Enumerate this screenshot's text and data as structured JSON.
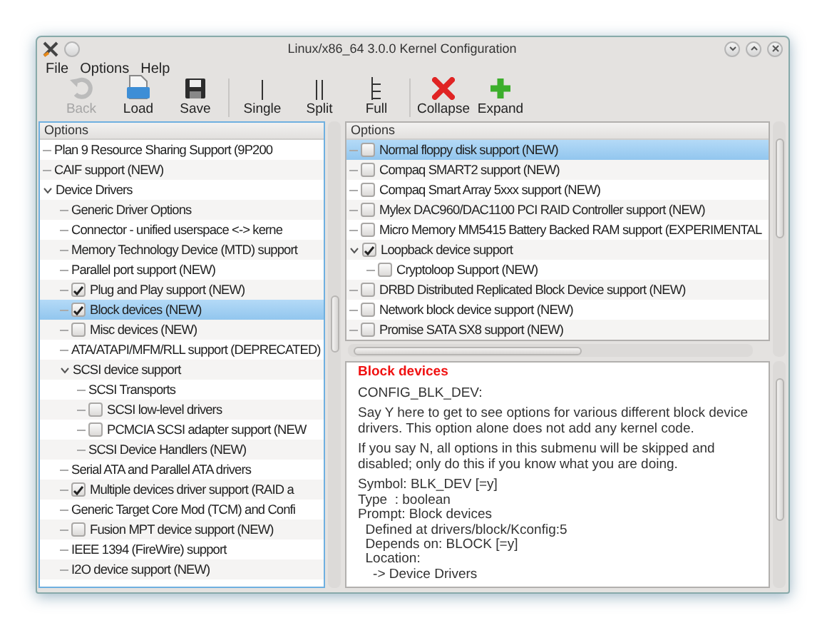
{
  "window": {
    "title": "Linux/x86_64 3.0.0 Kernel Configuration"
  },
  "menu": [
    "File",
    "Options",
    "Help"
  ],
  "toolbar": [
    [
      {
        "label": "Back",
        "disabled": true
      },
      {
        "label": "Load",
        "disabled": false
      },
      {
        "label": "Save",
        "disabled": false
      }
    ],
    [
      {
        "label": "Single",
        "disabled": false
      },
      {
        "label": "Split",
        "disabled": false
      },
      {
        "label": "Full",
        "disabled": false
      }
    ],
    [
      {
        "label": "Collapse",
        "disabled": false
      },
      {
        "label": "Expand",
        "disabled": false
      }
    ]
  ],
  "menu_tree": {
    "header": "Options",
    "items": [
      {
        "label": "Plan 9 Resource Sharing Support (9P200",
        "kind": "plain",
        "selected": false
      },
      {
        "label": "CAIF support (NEW)",
        "kind": "plain",
        "selected": false
      },
      {
        "label": "Device Drivers",
        "kind": "plain",
        "selected": false,
        "expanded": true,
        "children": [
          {
            "label": "Generic Driver Options",
            "kind": "plain",
            "selected": false
          },
          {
            "label": "Connector - unified userspace <-> kerne",
            "kind": "plain",
            "selected": false
          },
          {
            "label": "Memory Technology Device (MTD) support",
            "kind": "plain",
            "selected": false
          },
          {
            "label": "Parallel port support (NEW)",
            "kind": "plain",
            "selected": false
          },
          {
            "label": "Plug and Play support (NEW)",
            "kind": "check",
            "checked": true,
            "selected": false
          },
          {
            "label": "Block devices (NEW)",
            "kind": "check",
            "checked": true,
            "selected": true
          },
          {
            "label": "Misc devices (NEW)",
            "kind": "check",
            "checked": false,
            "selected": false
          },
          {
            "label": "ATA/ATAPI/MFM/RLL support (DEPRECATED)",
            "kind": "plain",
            "selected": false
          },
          {
            "label": "SCSI device support",
            "kind": "plain",
            "selected": false,
            "expanded": true,
            "children": [
              {
                "label": "SCSI Transports",
                "kind": "plain",
                "selected": false
              },
              {
                "label": "SCSI low-level drivers",
                "kind": "check",
                "checked": false,
                "selected": false
              },
              {
                "label": "PCMCIA SCSI adapter support (NEW",
                "kind": "check",
                "checked": false,
                "selected": false
              },
              {
                "label": "SCSI Device Handlers (NEW)",
                "kind": "plain",
                "selected": false
              }
            ]
          },
          {
            "label": "Serial ATA and Parallel ATA drivers",
            "kind": "plain",
            "selected": false
          },
          {
            "label": "Multiple devices driver support (RAID a",
            "kind": "check",
            "checked": true,
            "selected": false
          },
          {
            "label": "Generic Target Core Mod (TCM) and Confi",
            "kind": "plain",
            "selected": false
          },
          {
            "label": "Fusion MPT device support (NEW)",
            "kind": "check",
            "checked": false,
            "selected": false
          },
          {
            "label": "IEEE 1394 (FireWire) support",
            "kind": "plain",
            "selected": false
          },
          {
            "label": "I2O device support (NEW)",
            "kind": "plain",
            "selected": false
          }
        ]
      }
    ]
  },
  "config_list": {
    "header": "Options",
    "items": [
      {
        "label": "Normal floppy disk support (NEW)",
        "kind": "check",
        "checked": false,
        "selected": true
      },
      {
        "label": "Compaq SMART2 support (NEW)",
        "kind": "check",
        "checked": false,
        "selected": false
      },
      {
        "label": "Compaq Smart Array 5xxx support (NEW)",
        "kind": "check",
        "checked": false,
        "selected": false
      },
      {
        "label": "Mylex DAC960/DAC1100 PCI RAID Controller support (NEW)",
        "kind": "check",
        "checked": false,
        "selected": false
      },
      {
        "label": "Micro Memory MM5415 Battery Backed RAM support (EXPERIMENTAL",
        "kind": "check",
        "checked": false,
        "selected": false
      },
      {
        "label": "Loopback device support",
        "kind": "check",
        "checked": true,
        "selected": false,
        "expanded": true,
        "children": [
          {
            "label": "Cryptoloop Support (NEW)",
            "kind": "check",
            "checked": false,
            "selected": false
          }
        ]
      },
      {
        "label": "DRBD Distributed Replicated Block Device support (NEW)",
        "kind": "check",
        "checked": false,
        "selected": false
      },
      {
        "label": "Network block device support (NEW)",
        "kind": "check",
        "checked": false,
        "selected": false
      },
      {
        "label": "Promise SATA SX8 support (NEW)",
        "kind": "check",
        "checked": false,
        "selected": false
      }
    ]
  },
  "help": {
    "title": "Block devices",
    "paragraphs": [
      "CONFIG_BLK_DEV:",
      "Say Y here to get to see options for various different block device drivers. This option alone does not add any kernel code.",
      "If you say N, all options in this submenu will be skipped and disabled; only do this if you know what you are doing."
    ],
    "details": [
      "Symbol: BLK_DEV [=y]",
      "Type  : boolean",
      "Prompt: Block devices",
      "  Defined at drivers/block/Kconfig:5",
      "  Depends on: BLOCK [=y]",
      "  Location:",
      "    -> Device Drivers"
    ]
  }
}
